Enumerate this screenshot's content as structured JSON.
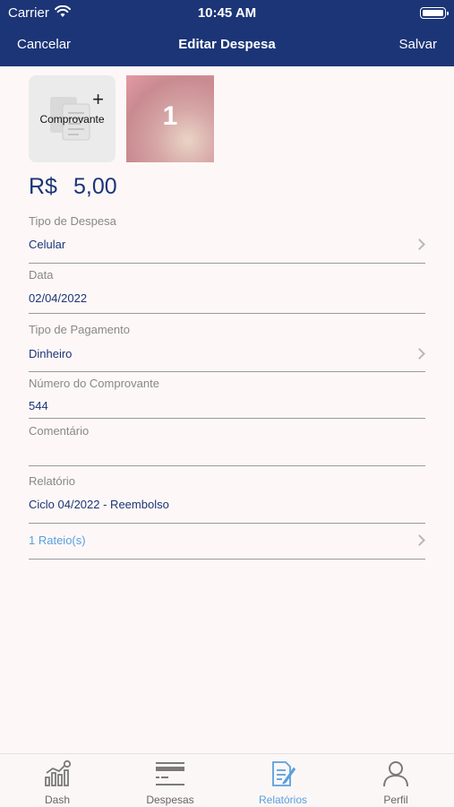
{
  "status": {
    "carrier": "Carrier",
    "time": "10:45 AM"
  },
  "nav": {
    "cancel": "Cancelar",
    "title": "Editar Despesa",
    "save": "Salvar"
  },
  "receipt": {
    "label": "Comprovante",
    "plus": "+",
    "count": "1"
  },
  "amount": {
    "currency": "R$",
    "value": "5,00"
  },
  "fields": {
    "tipo_despesa": {
      "label": "Tipo de Despesa",
      "value": "Celular"
    },
    "data": {
      "label": "Data",
      "value": "02/04/2022"
    },
    "tipo_pagamento": {
      "label": "Tipo de Pagamento",
      "value": "Dinheiro"
    },
    "numero_comprovante": {
      "label": "Número do Comprovante",
      "value": "544"
    },
    "comentario": {
      "label": "Comentário",
      "value": ""
    },
    "relatorio": {
      "label": "Relatório",
      "value": "Ciclo 04/2022 - Reembolso"
    }
  },
  "rateio": {
    "label": "1 Rateio(s)"
  },
  "tabs": [
    {
      "label": "Dash",
      "icon": "chart-icon"
    },
    {
      "label": "Despesas",
      "icon": "card-icon"
    },
    {
      "label": "Relatórios",
      "icon": "report-icon"
    },
    {
      "label": "Perfil",
      "icon": "user-icon"
    }
  ],
  "colors": {
    "navbar": "#1c3577",
    "accent": "#5aa0e0",
    "background": "#fdf8f7"
  }
}
